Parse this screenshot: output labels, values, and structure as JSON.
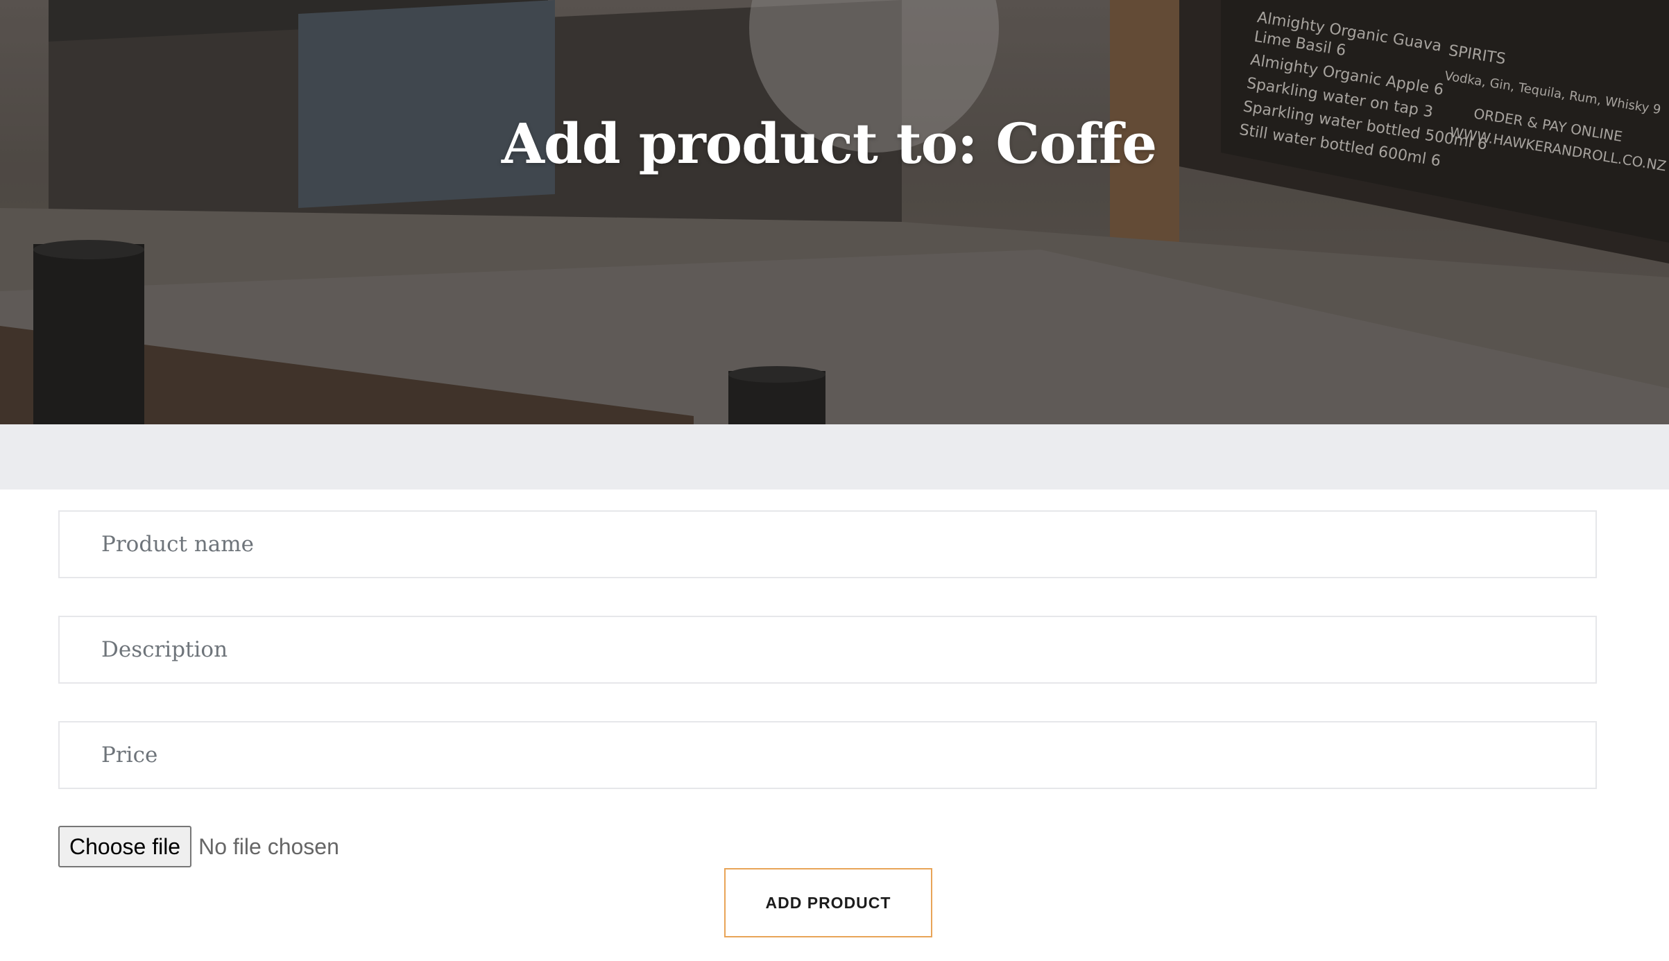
{
  "hero": {
    "title": "Add product to: Coffe",
    "menu_board_lines": [
      "Almighty Organic Guava",
      "Lime Basil 6",
      "Almighty Organic Apple 6",
      "Sparkling water on tap 3",
      "Sparkling water bottled 500ml 6",
      "Still water bottled 600ml 6",
      "SPIRITS",
      "Vodka, Gin, Tequila, Rum, Whisky 9",
      "ORDER & PAY ONLINE",
      "WWW.HAWKERANDROLL.CO.NZ"
    ]
  },
  "form": {
    "product_name": {
      "placeholder": "Product name",
      "value": ""
    },
    "description": {
      "placeholder": "Description",
      "value": ""
    },
    "price": {
      "placeholder": "Price",
      "value": ""
    },
    "file": {
      "button_label": "Choose file",
      "status": "No file chosen"
    },
    "submit_label": "ADD PRODUCT"
  },
  "colors": {
    "band": "#ebecef",
    "field_border": "#e6e7ea",
    "submit_border": "#e8a457"
  }
}
